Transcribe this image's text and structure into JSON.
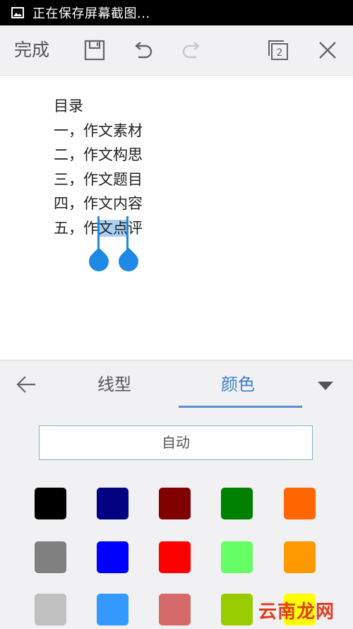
{
  "status_bar": {
    "text": "正在保存屏幕截图...",
    "icon": "image-icon"
  },
  "toolbar": {
    "done_label": "完成",
    "icons": [
      "save-icon",
      "undo-icon",
      "redo-icon",
      "pages-icon",
      "close-icon"
    ],
    "page_count": "2"
  },
  "document": {
    "lines": [
      "目录",
      "一，作文素材",
      "二，作文构思",
      "三，作文题目",
      "四，作文内容"
    ],
    "last_line": {
      "before": "五，作",
      "selected": "文点",
      "after": "评"
    }
  },
  "panel": {
    "tabs": [
      {
        "label": "线型",
        "active": false
      },
      {
        "label": "颜色",
        "active": true
      }
    ],
    "back_icon": "arrow-left-icon",
    "dropdown_icon": "triangle-down-icon",
    "auto_label": "自动",
    "colors": [
      [
        "#000000",
        "#000080",
        "#800000",
        "#008000",
        "#ff6600"
      ],
      [
        "#808080",
        "#0000ff",
        "#ff0000",
        "#66ff66",
        "#ff9900"
      ],
      [
        "#c0c0c0",
        "#3399ff",
        "#d46a6a",
        "#99cc00",
        "#ffff00"
      ]
    ],
    "accent_color": "#3a7fc9",
    "selection_color": "#1e88e5"
  },
  "watermark": "云南龙网"
}
